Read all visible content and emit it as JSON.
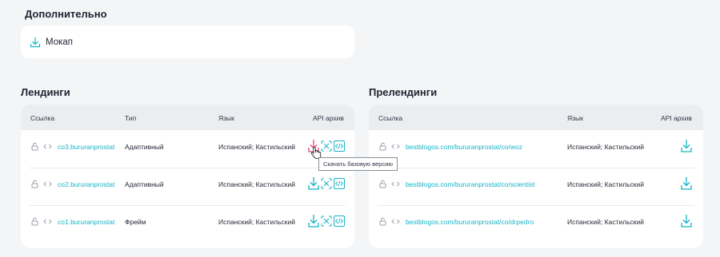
{
  "extra": {
    "title": "Дополнительно",
    "item_label": "Мокап"
  },
  "landings": {
    "title": "Лендинги",
    "headers": {
      "link": "Ссылка",
      "type": "Тип",
      "lang": "Язык",
      "api": "API архив"
    },
    "rows": [
      {
        "link": "co3.bururanprostat",
        "type": "Адаптивный",
        "lang": "Испанский; Кастильский"
      },
      {
        "link": "co2.bururanprostat",
        "type": "Адаптивный",
        "lang": "Испанский; Кастильский"
      },
      {
        "link": "co1.bururanprostat",
        "type": "Фрейм",
        "lang": "Испанский; Кастильский"
      }
    ],
    "tooltip": "Скачать базовую версию"
  },
  "prelandings": {
    "title": "Прелендинги",
    "headers": {
      "link": "Ссылка",
      "lang": "Язык",
      "api": "API архив"
    },
    "rows": [
      {
        "link": "bestblogos.com/bururanprostat/co/woz",
        "lang": "Испанский; Кастильский"
      },
      {
        "link": "bestblogos.com/bururanprostat/co/scientist",
        "lang": "Испанский; Кастильский"
      },
      {
        "link": "bestblogos.com/bururanprostat/co/drpedro",
        "lang": "Испанский; Кастильский"
      }
    ]
  },
  "colors": {
    "accent": "#16b4c6",
    "highlight": "#e8457a",
    "icon_gray": "#9aa1ab"
  }
}
